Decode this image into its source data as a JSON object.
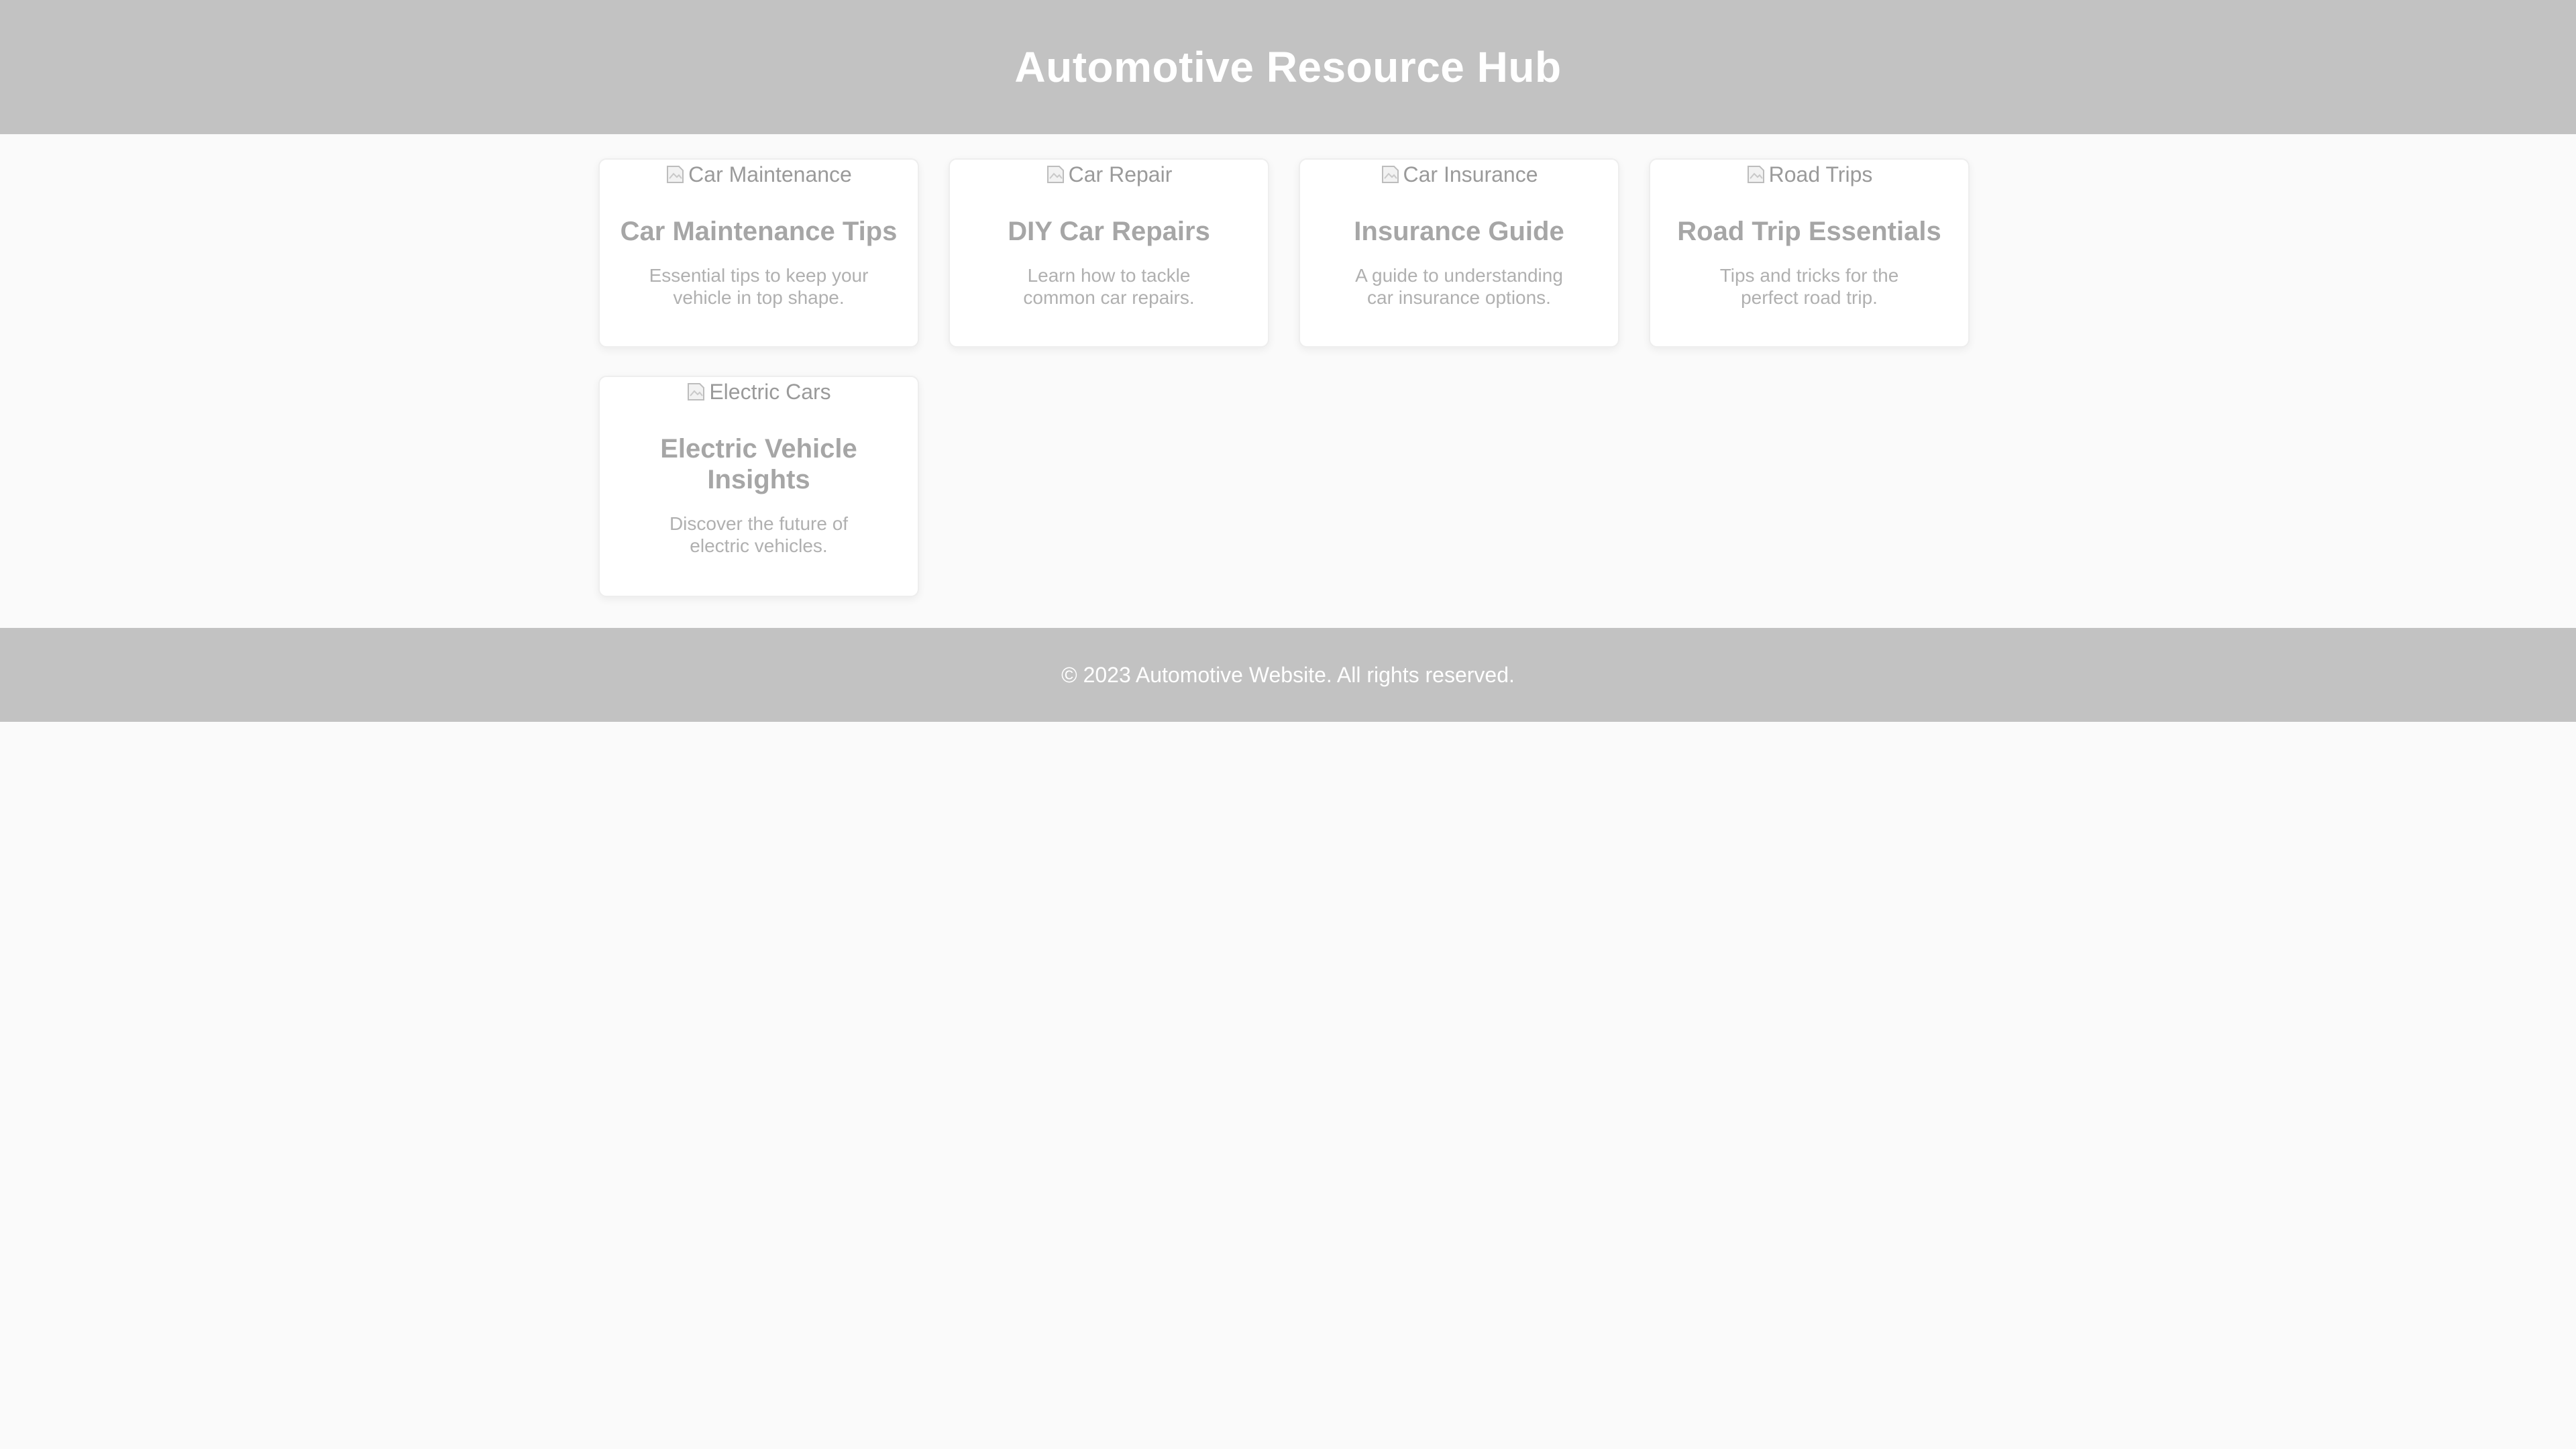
{
  "header": {
    "title": "Automotive Resource Hub"
  },
  "cards": [
    {
      "image_alt": "Car Maintenance",
      "title": "Car Maintenance Tips",
      "description": "Essential tips to keep your vehicle in top shape."
    },
    {
      "image_alt": "Car Repair",
      "title": "DIY Car Repairs",
      "description": "Learn how to tackle common car repairs."
    },
    {
      "image_alt": "Car Insurance",
      "title": "Insurance Guide",
      "description": "A guide to understanding car insurance options."
    },
    {
      "image_alt": "Road Trips",
      "title": "Road Trip Essentials",
      "description": "Tips and tricks for the perfect road trip."
    },
    {
      "image_alt": "Electric Cars",
      "title": "Electric Vehicle Insights",
      "description": "Discover the future of electric vehicles."
    }
  ],
  "footer": {
    "text": "© 2023 Automotive Website. All rights reserved."
  },
  "colors": {
    "header_bg": "#c2c2c2",
    "footer_bg": "#c2c2c2",
    "page_bg": "#fafafa",
    "card_bg": "#ffffff"
  },
  "icons": {
    "card_image": "broken-image-icon"
  }
}
